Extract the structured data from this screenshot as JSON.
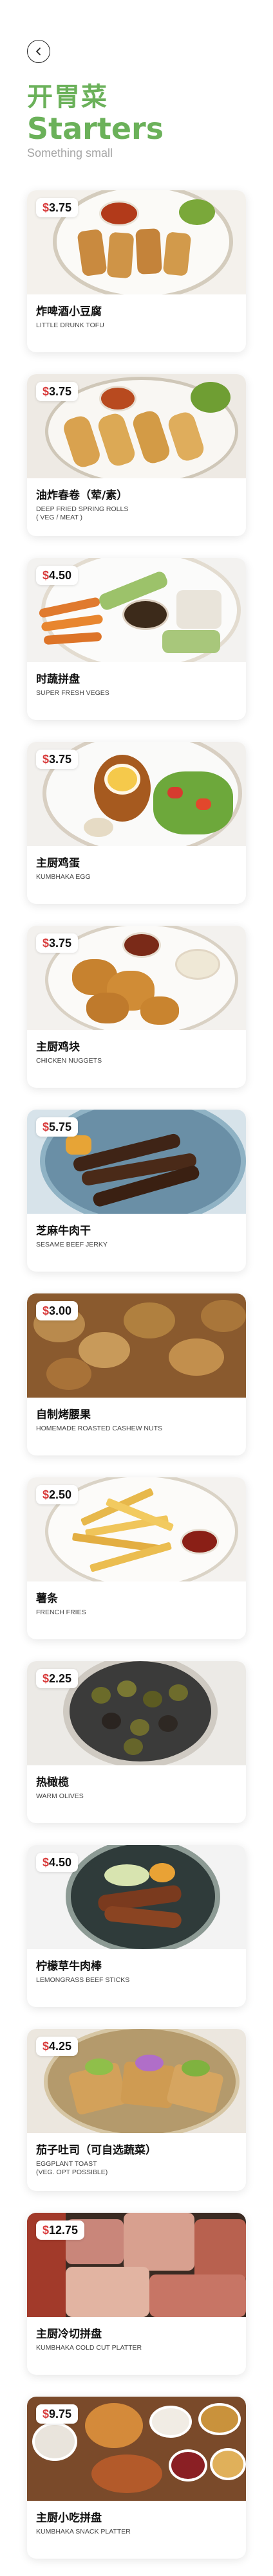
{
  "header": {
    "back_icon": "chevron-left-icon",
    "title_cn": "开胃菜",
    "title_en": "Starters",
    "subtitle": "Something small"
  },
  "colors": {
    "brand_green": "#6bb15a",
    "price_currency": "#d83a3a"
  },
  "items": [
    {
      "currency": "$",
      "price": "3.75",
      "name_cn": "炸啤酒小豆腐",
      "name_en": "LITTLE DRUNK TOFU"
    },
    {
      "currency": "$",
      "price": "3.75",
      "name_cn": "油炸春卷（荤/素）",
      "name_en": "DEEP FRIED SPRING ROLLS\n( VEG / MEAT )"
    },
    {
      "currency": "$",
      "price": "4.50",
      "name_cn": "时蔬拼盘",
      "name_en": "SUPER FRESH VEGES"
    },
    {
      "currency": "$",
      "price": "3.75",
      "name_cn": "主厨鸡蛋",
      "name_en": "KUMBHAKA EGG"
    },
    {
      "currency": "$",
      "price": "3.75",
      "name_cn": "主厨鸡块",
      "name_en": "CHICKEN NUGGETS"
    },
    {
      "currency": "$",
      "price": "5.75",
      "name_cn": "芝麻牛肉干",
      "name_en": "SESAME BEEF JERKY"
    },
    {
      "currency": "$",
      "price": "3.00",
      "name_cn": "自制烤腰果",
      "name_en": "HOMEMADE ROASTED CASHEW NUTS"
    },
    {
      "currency": "$",
      "price": "2.50",
      "name_cn": "薯条",
      "name_en": "FRENCH FRIES"
    },
    {
      "currency": "$",
      "price": "2.25",
      "name_cn": "热橄榄",
      "name_en": "WARM OLIVES"
    },
    {
      "currency": "$",
      "price": "4.50",
      "name_cn": "柠檬草牛肉棒",
      "name_en": "LEMONGRASS BEEF STICKS"
    },
    {
      "currency": "$",
      "price": "4.25",
      "name_cn": "茄子吐司（可自选蔬菜）",
      "name_en": "EGGPLANT TOAST\n(VEG. OPT POSSIBLE)"
    },
    {
      "currency": "$",
      "price": "12.75",
      "name_cn": "主厨冷切拼盘",
      "name_en": "KUMBHAKA COLD CUT PLATTER"
    },
    {
      "currency": "$",
      "price": "9.75",
      "name_cn": "主厨小吃拼盘",
      "name_en": "KUMBHAKA SNACK PLATTER"
    }
  ]
}
